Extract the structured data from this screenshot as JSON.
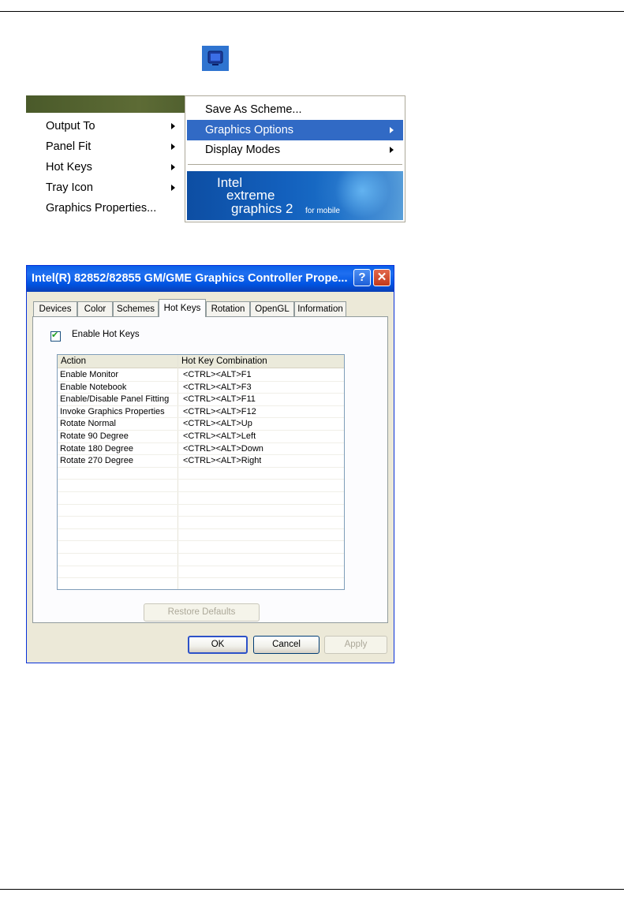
{
  "context_menu": {
    "left_items": [
      {
        "label": "Output To",
        "submenu": true
      },
      {
        "label": "Panel Fit",
        "submenu": true
      },
      {
        "label": "Hot Keys",
        "submenu": true
      },
      {
        "label": "Tray Icon",
        "submenu": true
      },
      {
        "label": "Graphics Properties...",
        "submenu": false
      }
    ],
    "right_items": [
      {
        "label": "Save As Scheme...",
        "submenu": false
      },
      {
        "label": "Graphics Options",
        "submenu": true,
        "selected": true
      },
      {
        "label": "Display Modes",
        "submenu": true
      }
    ],
    "banner": {
      "line1": "Intel",
      "line2": "extreme",
      "line3": "graphics 2",
      "line4": "for mobile"
    },
    "selected_color": "#316ac5"
  },
  "dialog": {
    "title": "Intel(R) 82852/82855 GM/GME Graphics Controller Prope...",
    "help_glyph": "?",
    "close_glyph": "✕",
    "tabs": [
      "Devices",
      "Color",
      "Schemes",
      "Hot Keys",
      "Rotation",
      "OpenGL",
      "Information"
    ],
    "active_tab": "Hot Keys",
    "enable_hot_keys": {
      "label": "Enable Hot Keys",
      "checked": true,
      "mark": "✔"
    },
    "columns": [
      "Action",
      "Hot Key Combination"
    ],
    "rows": [
      [
        "Enable Monitor",
        "<CTRL><ALT>F1"
      ],
      [
        "Enable Notebook",
        "<CTRL><ALT>F3"
      ],
      [
        "Enable/Disable Panel Fitting",
        "<CTRL><ALT>F11"
      ],
      [
        "Invoke Graphics Properties",
        "<CTRL><ALT>F12"
      ],
      [
        "Rotate Normal",
        "<CTRL><ALT>Up"
      ],
      [
        "Rotate 90 Degree",
        "<CTRL><ALT>Left"
      ],
      [
        "Rotate 180 Degree",
        "<CTRL><ALT>Down"
      ],
      [
        "Rotate 270 Degree",
        "<CTRL><ALT>Right"
      ]
    ],
    "restore_defaults": "Restore Defaults",
    "ok": "OK",
    "cancel": "Cancel",
    "apply": "Apply",
    "titlebar_color": "#0054e3"
  }
}
